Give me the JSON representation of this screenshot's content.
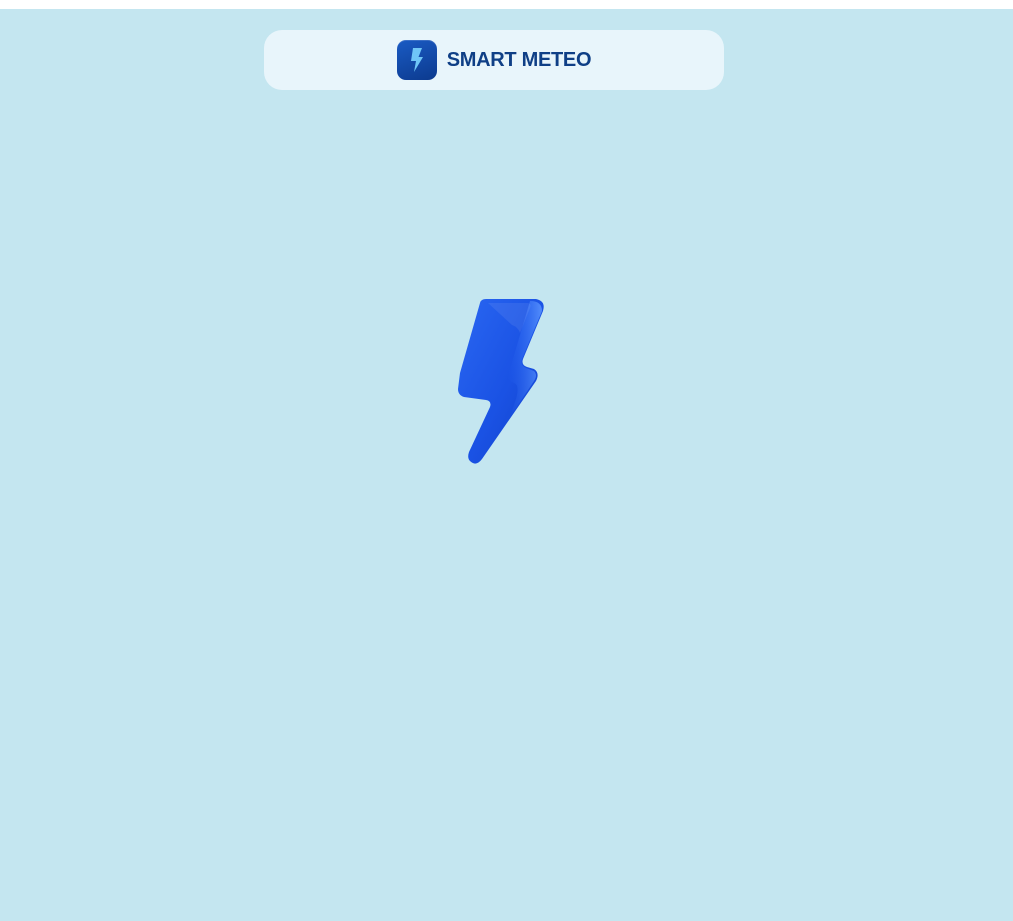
{
  "header": {
    "title": "SMART METEO",
    "logo_icon": "lightning-bolt-icon"
  },
  "main": {
    "hero_icon": "lightning-bolt-icon"
  },
  "colors": {
    "background": "#c4e6f0",
    "header_bar": "#e8f5fb",
    "title_text": "#0f3f86",
    "bolt": "#1a55e6"
  }
}
